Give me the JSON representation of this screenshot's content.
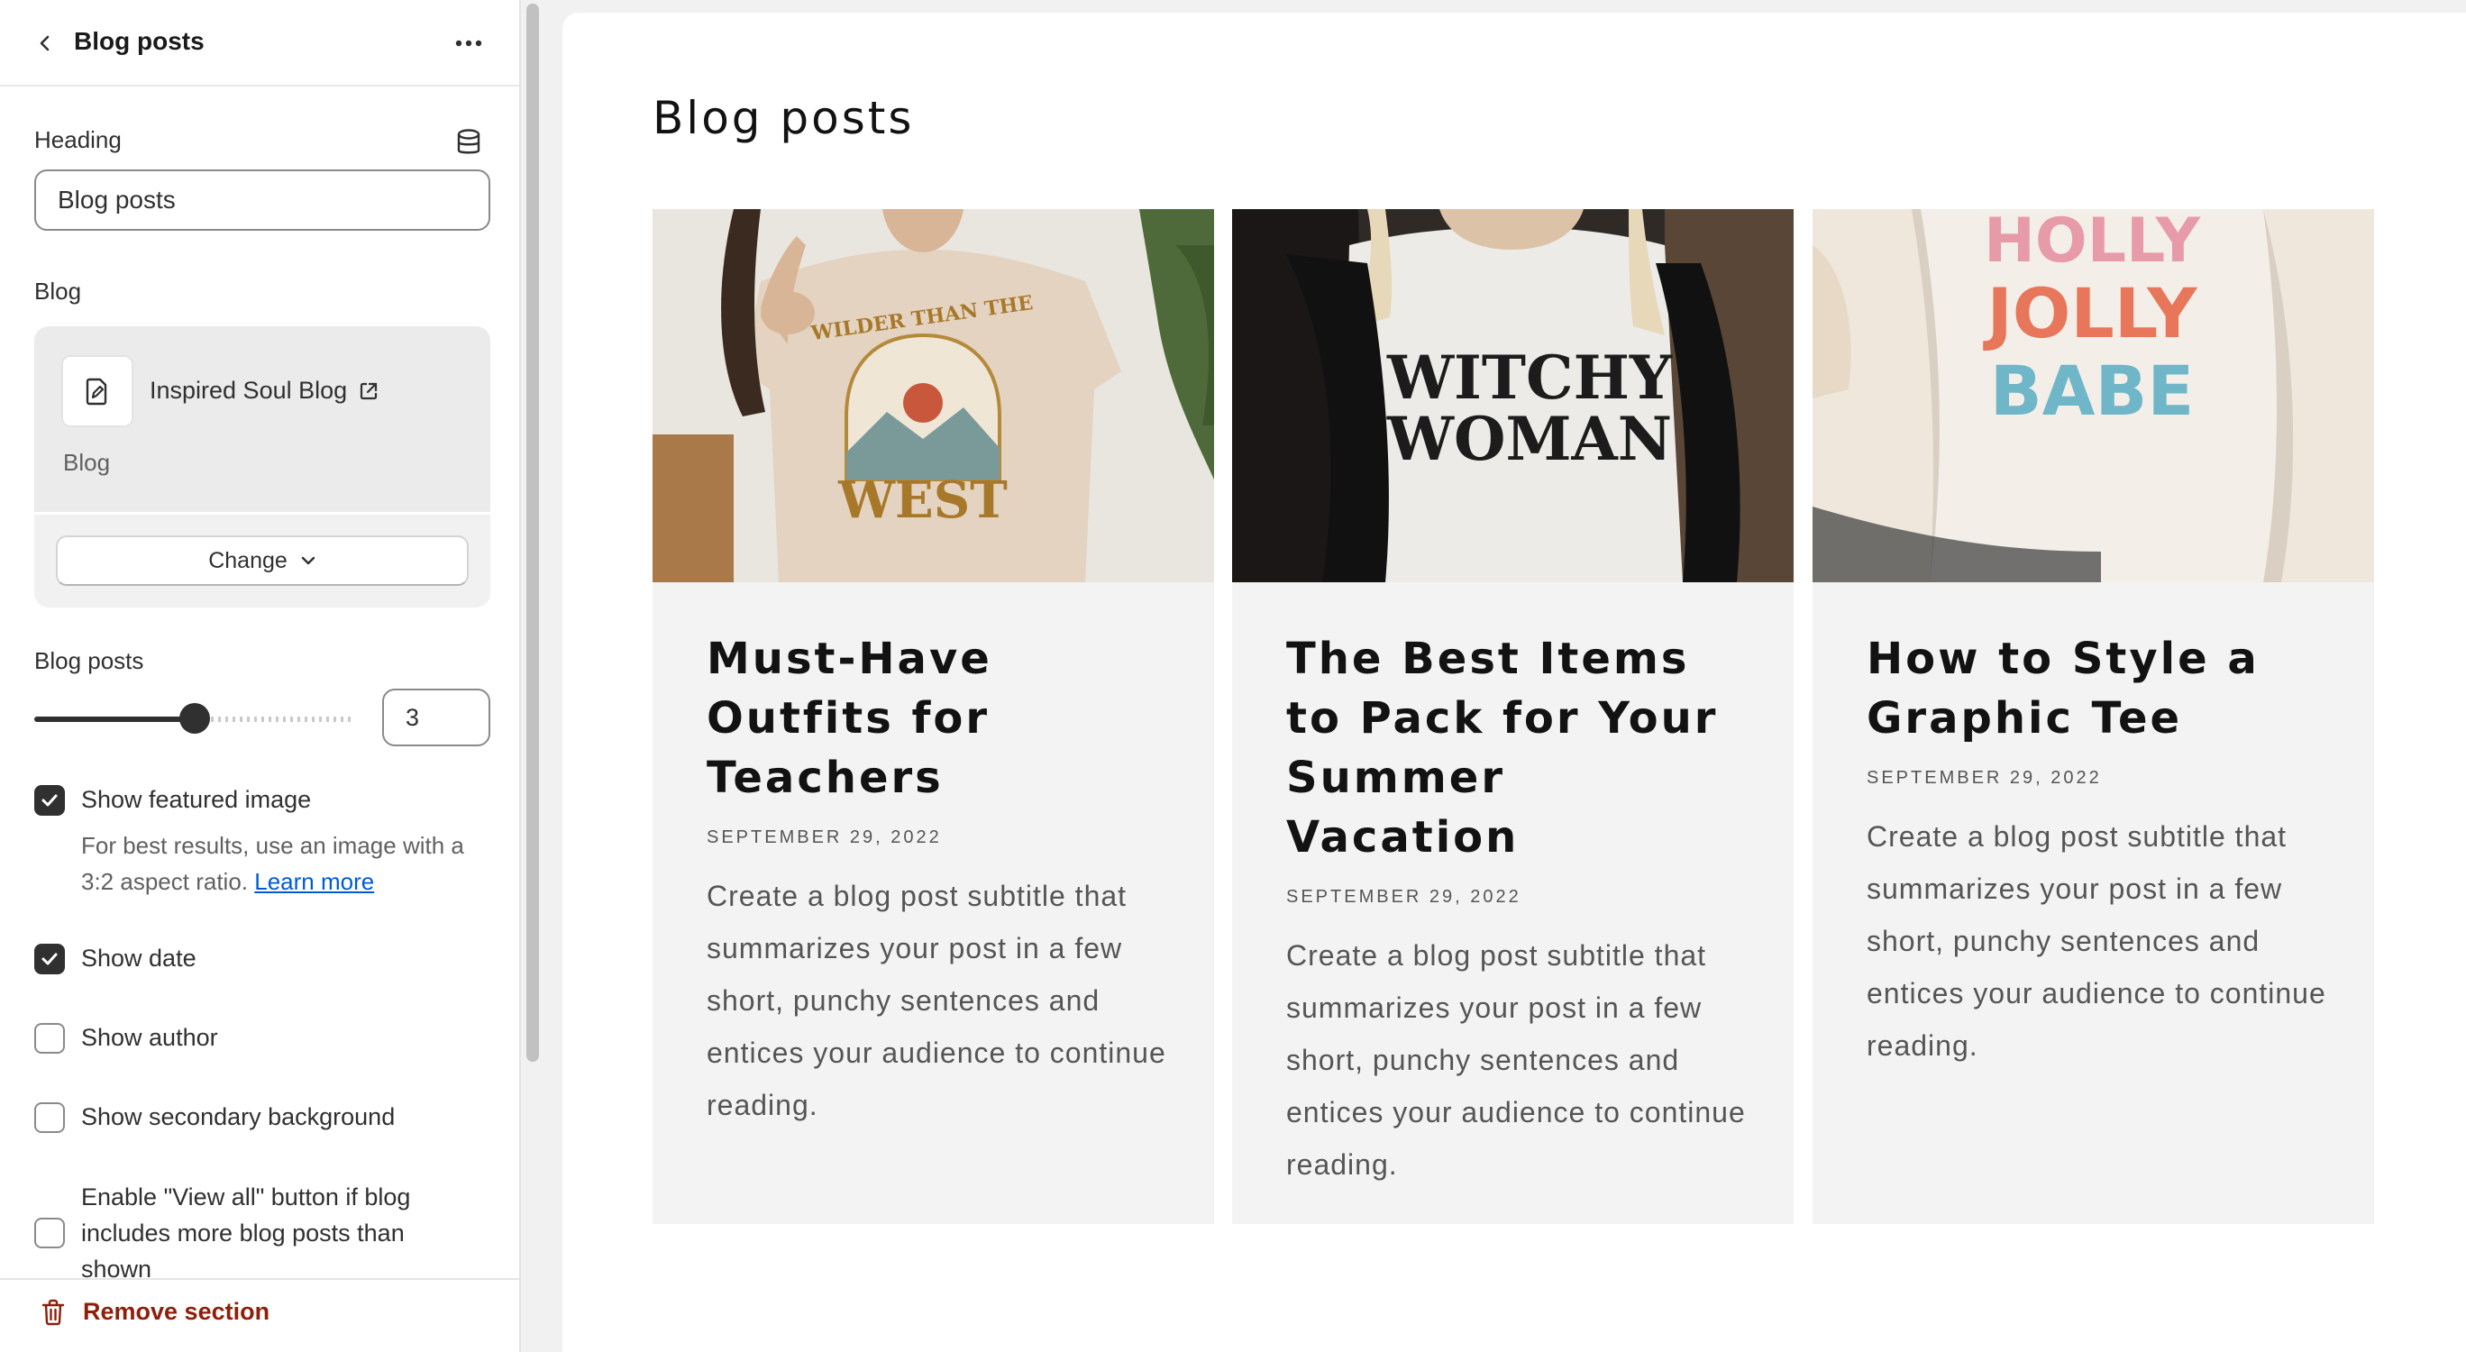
{
  "panel": {
    "title": "Blog posts",
    "heading_label": "Heading",
    "heading_value": "Blog posts",
    "blog_label": "Blog",
    "blog_name": "Inspired Soul Blog",
    "blog_type": "Blog",
    "change_label": "Change",
    "posts_label": "Blog posts",
    "posts_count": "3",
    "posts_slider_fraction": 0.5,
    "show_featured_image": {
      "label": "Show featured image",
      "checked": true
    },
    "help_text": "For best results, use an image with a 3:2 aspect ratio.",
    "help_link": "Learn more",
    "show_date": {
      "label": "Show date",
      "checked": true
    },
    "show_author": {
      "label": "Show author",
      "checked": false
    },
    "show_secondary_background": {
      "label": "Show secondary background",
      "checked": false
    },
    "view_all": {
      "label": "Enable \"View all\" button if blog includes more blog posts than shown",
      "checked": false
    },
    "remove_label": "Remove section"
  },
  "preview": {
    "section_title": "Blog posts",
    "posts": [
      {
        "title": "Must-Have Outfits for Teachers",
        "date": "SEPTEMBER 29, 2022",
        "excerpt": "Create a blog post subtitle that summarizes your post in a few short, punchy sentences and entices your audience to continue reading.",
        "shirt_text": [
          "WILDER THAN THE",
          "WEST"
        ]
      },
      {
        "title": "The Best Items to Pack for Your Summer Vacation",
        "date": "SEPTEMBER 29, 2022",
        "excerpt": "Create a blog post subtitle that summarizes your post in a few short, punchy sentences and entices your audience to continue reading.",
        "shirt_text": [
          "WITCHY",
          "WOMAN"
        ]
      },
      {
        "title": "How to Style a Graphic Tee",
        "date": "SEPTEMBER 29, 2022",
        "excerpt": "Create a blog post subtitle that summarizes your post in a few short, punchy sentences and entices your audience to continue reading.",
        "shirt_text": [
          "HOLLY",
          "JOLLY",
          "BABE"
        ]
      }
    ]
  },
  "colors": {
    "accent_dark": "#303030",
    "link": "#005bd3",
    "danger": "#8e1f0b",
    "card_bg": "#f3f3f3"
  }
}
